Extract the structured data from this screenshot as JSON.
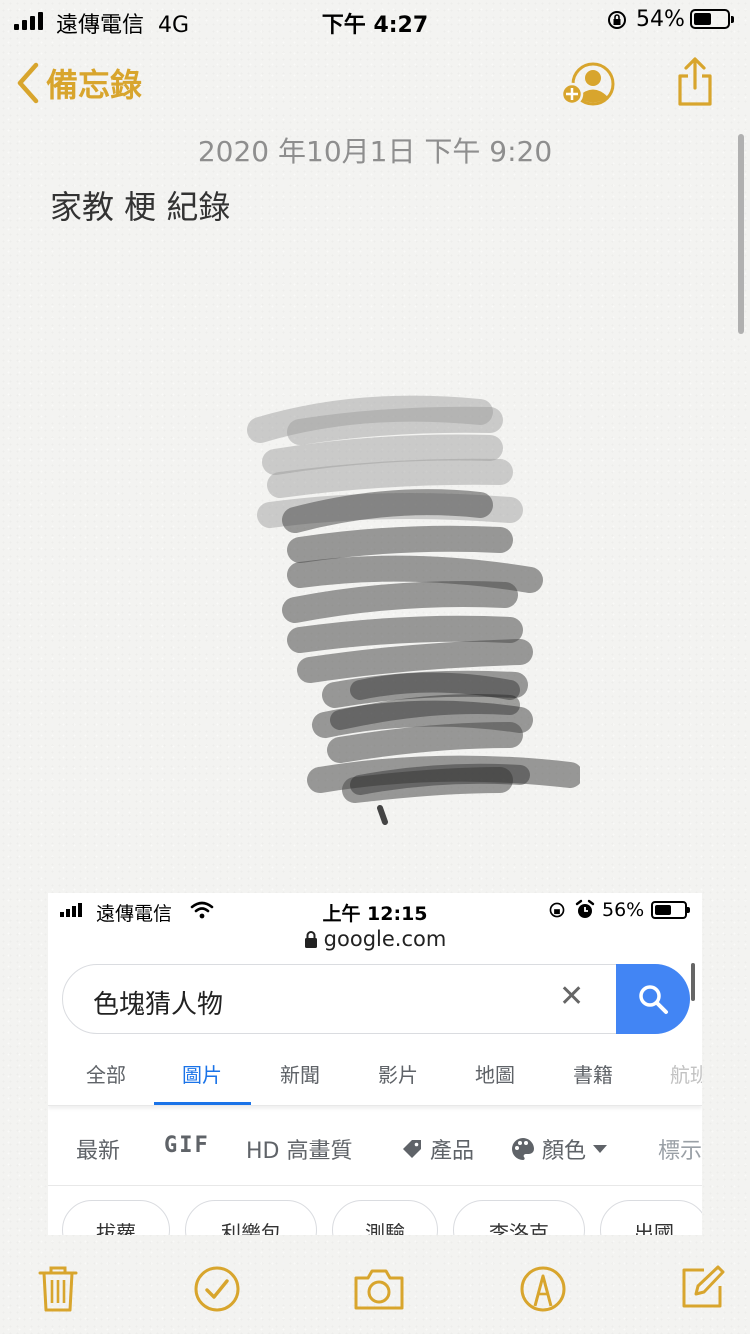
{
  "status_bar": {
    "carrier": "遠傳電信",
    "network": "4G",
    "time": "下午 4:27",
    "battery_percent": "54%",
    "battery_level": 0.54
  },
  "nav": {
    "back_label": "備忘錄",
    "icons": [
      "add-person-icon",
      "share-icon"
    ]
  },
  "note": {
    "date": "2020 年10月1日 下午 9:20",
    "title": "家教 梗 紀錄"
  },
  "embedded_screenshot": {
    "status_bar": {
      "carrier": "遠傳電信",
      "time": "上午 12:15",
      "battery_percent": "56%",
      "battery_level": 0.56
    },
    "url": "google.com",
    "search_query": "色塊猜人物",
    "tabs": [
      "全部",
      "圖片",
      "新聞",
      "影片",
      "地圖",
      "書籍",
      "航班"
    ],
    "active_tab": "圖片",
    "filters": {
      "latest": "最新",
      "gif": "GIF",
      "hd": "HD 高畫質",
      "products": "產品",
      "color": "顏色",
      "labels": "標示"
    },
    "chips": [
      "拔蘿",
      "利樂包",
      "測驗",
      "李洛克",
      "出國"
    ]
  },
  "toolbar": {
    "icons": [
      "trash-icon",
      "checklist-icon",
      "camera-icon",
      "markup-icon",
      "compose-icon"
    ]
  },
  "colors": {
    "accent": "#d8a52d",
    "google_blue": "#4285f4",
    "tab_active": "#1a73e8"
  }
}
